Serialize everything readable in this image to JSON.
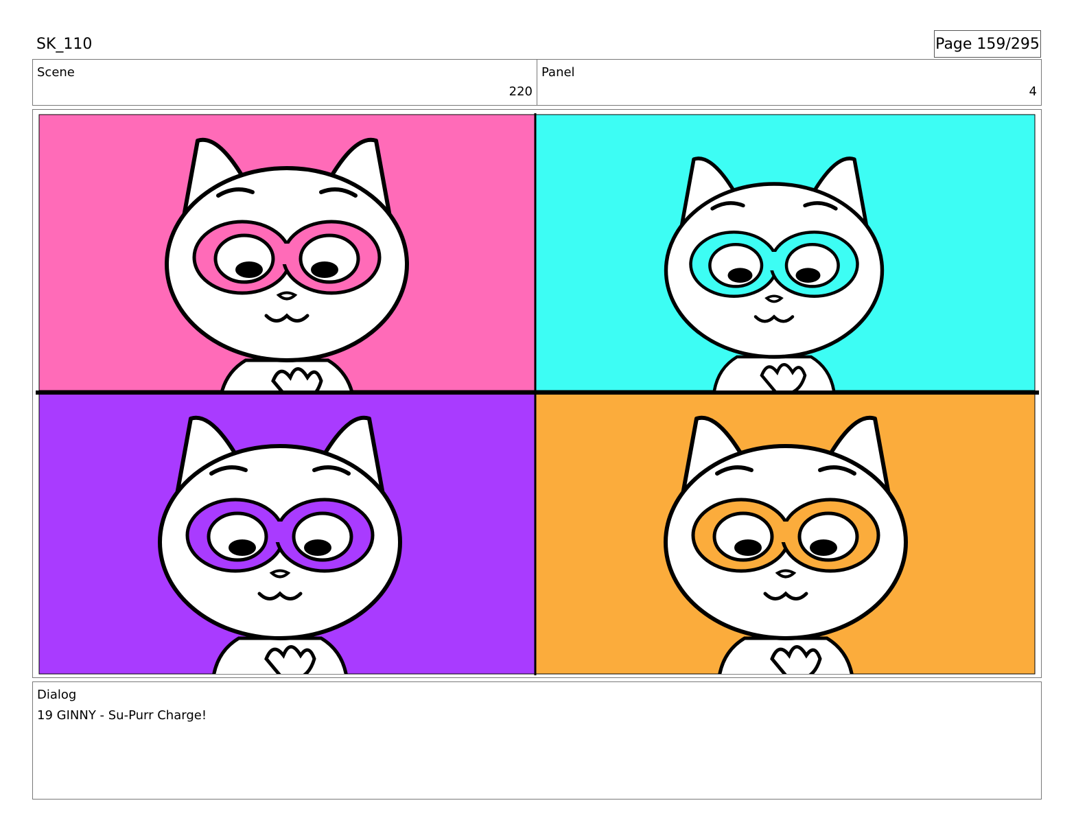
{
  "header": {
    "title": "SK_110",
    "page": "Page 159/295"
  },
  "info": {
    "scene_label": "Scene",
    "scene_value": "220",
    "panel_label": "Panel",
    "panel_value": "4"
  },
  "artwork": {
    "quadrants": [
      {
        "name": "top-left",
        "color": "#ff6bb8"
      },
      {
        "name": "top-right",
        "color": "#3dfdf4"
      },
      {
        "name": "bottom-left",
        "color": "#a93bff"
      },
      {
        "name": "bottom-right",
        "color": "#fbac3c"
      }
    ]
  },
  "dialog": {
    "label": "Dialog",
    "lines": [
      "19 GINNY - Su-Purr Charge!"
    ]
  }
}
